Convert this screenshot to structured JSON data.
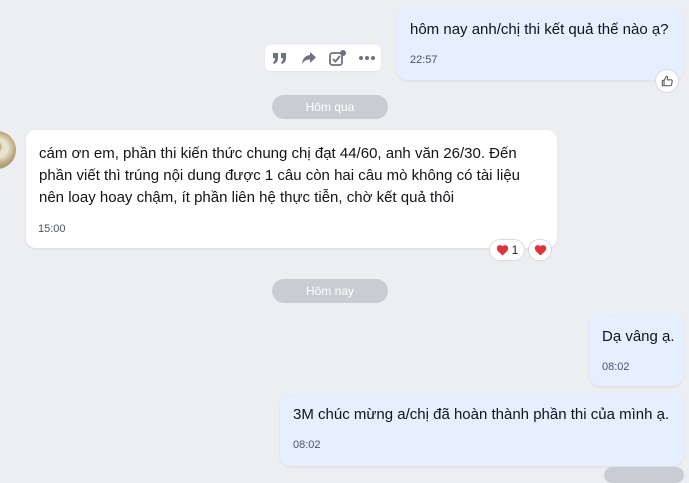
{
  "messages": [
    {
      "id": "m1",
      "side": "mine",
      "text": "hôm nay anh/chị thi kết quả thế nào ạ?",
      "time": "22:57"
    },
    {
      "id": "m2",
      "side": "theirs",
      "text_lines": [
        "cám ơn em, phần thi kiến thức chung chị đạt 44/60, anh văn 26/30. Đến",
        "phần viết thì trúng nội dung được 1 câu còn hai câu mò không có tài liệu",
        "nên loay hoay chậm, ít phần liên hệ thực tiễn, chờ kết quả thôi"
      ],
      "time": "15:00",
      "reaction_count": "1"
    },
    {
      "id": "m3",
      "side": "mine",
      "text": "Dạ vâng ạ.",
      "time": "08:02"
    },
    {
      "id": "m4",
      "side": "mine",
      "text": "3M chúc mừng a/chị đã hoàn thành phần thi của mình ạ.",
      "time": "08:02"
    }
  ],
  "dates": {
    "yesterday": "Hôm qua",
    "today": "Hôm nay"
  },
  "toolbar": {
    "icons": [
      "quote-icon",
      "forward-icon",
      "task-icon",
      "more-icon"
    ]
  },
  "colors": {
    "mine_bubble": "#e5efff",
    "theirs_bubble": "#ffffff",
    "background": "#eceef1",
    "heart": "#e0323c"
  }
}
